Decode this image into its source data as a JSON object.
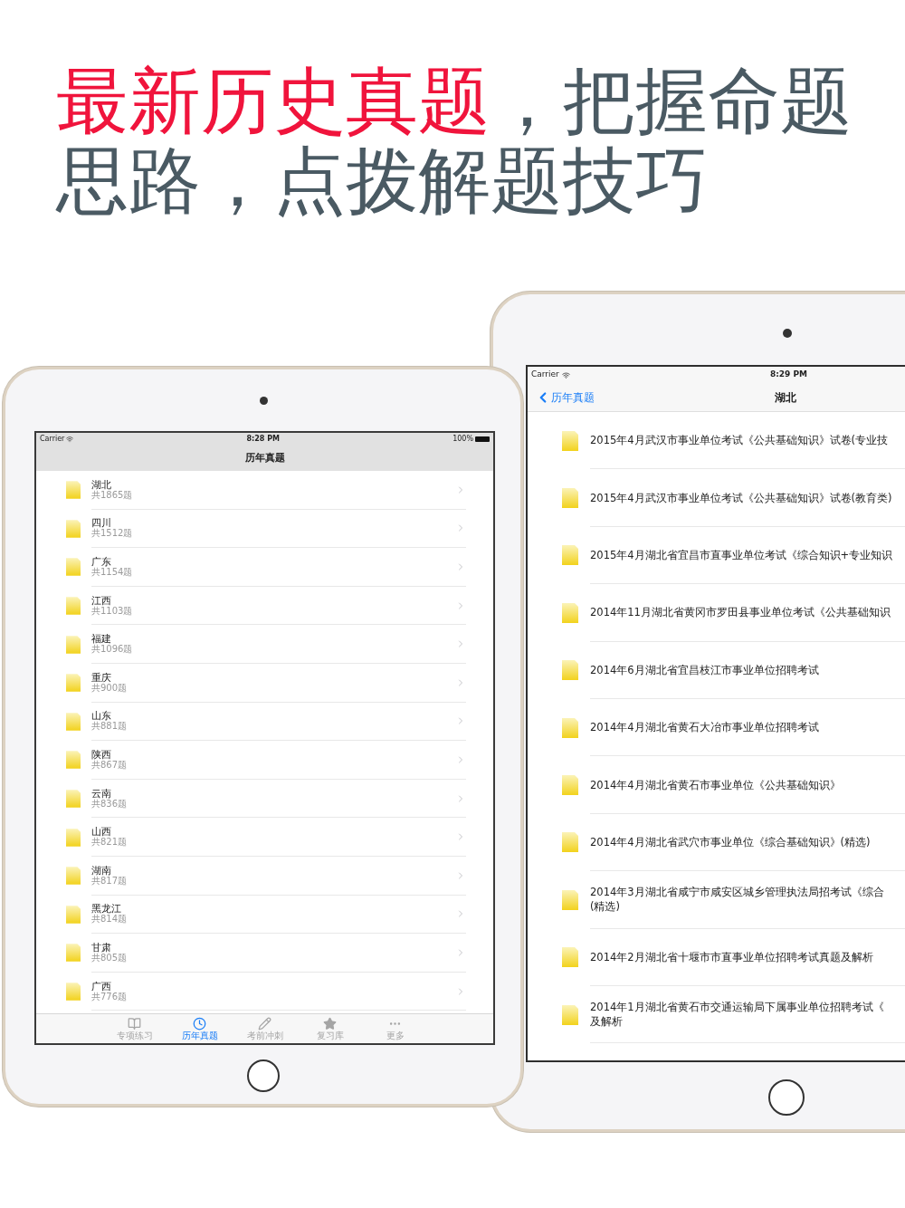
{
  "headline": {
    "lines": [
      [
        {
          "text": "最新历史真题",
          "highlight": true
        },
        {
          "text": "，把握命题",
          "highlight": false
        }
      ],
      [
        {
          "text": "思路，点拨解题技巧",
          "highlight": false
        }
      ]
    ]
  },
  "left_ipad": {
    "status_bar": {
      "carrier": "Carrier",
      "time": "8:28 PM",
      "battery": "100%"
    },
    "nav_title": "历年真题",
    "rows": [
      {
        "title": "湖北",
        "count": "共1865题"
      },
      {
        "title": "四川",
        "count": "共1512题"
      },
      {
        "title": "广东",
        "count": "共1154题"
      },
      {
        "title": "江西",
        "count": "共1103题"
      },
      {
        "title": "福建",
        "count": "共1096题"
      },
      {
        "title": "重庆",
        "count": "共900题"
      },
      {
        "title": "山东",
        "count": "共881题"
      },
      {
        "title": "陕西",
        "count": "共867题"
      },
      {
        "title": "云南",
        "count": "共836题"
      },
      {
        "title": "山西",
        "count": "共821题"
      },
      {
        "title": "湖南",
        "count": "共817题"
      },
      {
        "title": "黑龙江",
        "count": "共814题"
      },
      {
        "title": "甘肃",
        "count": "共805题"
      },
      {
        "title": "广西",
        "count": "共776题"
      }
    ],
    "tabs": [
      {
        "label": "专项练习",
        "selected": false
      },
      {
        "label": "历年真题",
        "selected": true
      },
      {
        "label": "考前冲刺",
        "selected": false
      },
      {
        "label": "复习库",
        "selected": false
      },
      {
        "label": "更多",
        "selected": false
      }
    ]
  },
  "right_ipad": {
    "status_bar": {
      "carrier": "Carrier",
      "time": "8:29 PM"
    },
    "nav": {
      "back": "历年真题",
      "title": "湖北"
    },
    "rows": [
      {
        "lines": [
          "2015年4月武汉市事业单位考试《公共基础知识》试卷(专业技"
        ]
      },
      {
        "lines": [
          "2015年4月武汉市事业单位考试《公共基础知识》试卷(教育类)"
        ]
      },
      {
        "lines": [
          "2015年4月湖北省宜昌市直事业单位考试《综合知识+专业知识"
        ]
      },
      {
        "lines": [
          "2014年11月湖北省黄冈市罗田县事业单位考试《公共基础知识"
        ]
      },
      {
        "lines": [
          "2014年6月湖北省宜昌枝江市事业单位招聘考试"
        ]
      },
      {
        "lines": [
          "2014年4月湖北省黄石大冶市事业单位招聘考试"
        ]
      },
      {
        "lines": [
          "2014年4月湖北省黄石市事业单位《公共基础知识》"
        ]
      },
      {
        "lines": [
          "2014年4月湖北省武穴市事业单位《综合基础知识》(精选)"
        ]
      },
      {
        "lines": [
          "2014年3月湖北省咸宁市咸安区城乡管理执法局招考试《综合",
          "(精选)"
        ]
      },
      {
        "lines": [
          "2014年2月湖北省十堰市市直事业单位招聘考试真题及解析"
        ]
      },
      {
        "lines": [
          "2014年1月湖北省黄石市交通运输局下属事业单位招聘考试《",
          "及解析"
        ]
      }
    ]
  }
}
